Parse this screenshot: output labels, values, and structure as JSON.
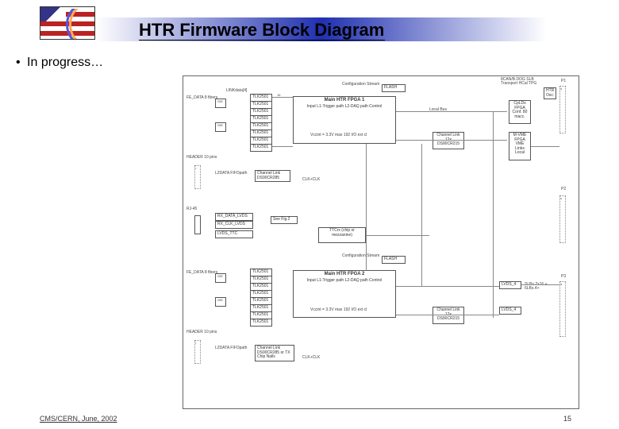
{
  "title": "HTR Firmware Block Diagram",
  "bullet": "In progress…",
  "footer_left": "CMS/CERN, June, 2002",
  "footer_right": "15",
  "diag": {
    "config_stream_1": "Configuration\nStream",
    "flash1": "FLASH",
    "main_fpga1": "Main HTR FPGA 1",
    "main_fpga1_sub": "Input\nL1-Trigger path\nL2-DAQ path\nControl",
    "vccint1": "Vccint = 3.3V\nmax 192 I/O ext cl",
    "fe_data1": "FE_DATA\n8 fibers",
    "linkdata_4": "LINKdata[4]",
    "oe": "O/E",
    "header1": "HEADER\n10 pins",
    "l2data1": "L2DATA\nFIFOpath",
    "channel_link1": "Channel Link\nDS90CR285",
    "clkclk": "CLK+CLK",
    "tlk_labels": [
      "TLK2501",
      "TLK2501",
      "TLK2501",
      "TLK2501",
      "TLK2501",
      "TLK2501",
      "TLK2501",
      "TLK2501"
    ],
    "rj45": "RJ-45",
    "rxdata_lvds": "RX_DATA_LVDS",
    "rxclk_lvds": "RX_CLK_LVDS",
    "lvds_ttc": "LVDS_TTC",
    "see_fig2": "See Fig.2",
    "ttcrx": "TTCrx (chip\nor mezzanine)",
    "config_stream_2": "Configuration\nStream",
    "flash2": "FLASH",
    "main_fpga2": "Main HTR FPGA 2",
    "main_fpga2_sub": "Input\nL1-Trigger path\nL2-DAQ path\nControl",
    "vccint2": "Vccint = 3.3V\nmax 192 I/O ext cl",
    "fe_data2": "FE_DATA\n8 fibers",
    "header2": "HEADER\n10 pins",
    "l2data2": "L2DATA\nFIFOpath",
    "channel_link2": "Channel Link\nDS90CR285 or\nTX Chip Nalls",
    "scanbeedog": "8CAN/B.DOG\nSLB Transport\nHCal TPG",
    "p1": "P1",
    "htr_osc": "HTR Osc:",
    "cpld": "CpLDs\nFPGA\nConf.\n80 macc.",
    "m_vme": "M-VME\nFPGA\nVME\nLinks\nLocal",
    "lvds1": "LVDS_4",
    "lvds2": "LVDS_4",
    "p3_right": "SLBs\n2x16 + 6LBs.4+",
    "local_bus": "Local Bus",
    "p2": "P2",
    "p3": "P3",
    "chan_link_12": "Channel\nLink 12x\nDS90CR215",
    "chan_link_12b": "Channel\nLink 12x\nDS90CR215",
    "clkclk2": "CLK+CLK",
    "16": "16"
  }
}
